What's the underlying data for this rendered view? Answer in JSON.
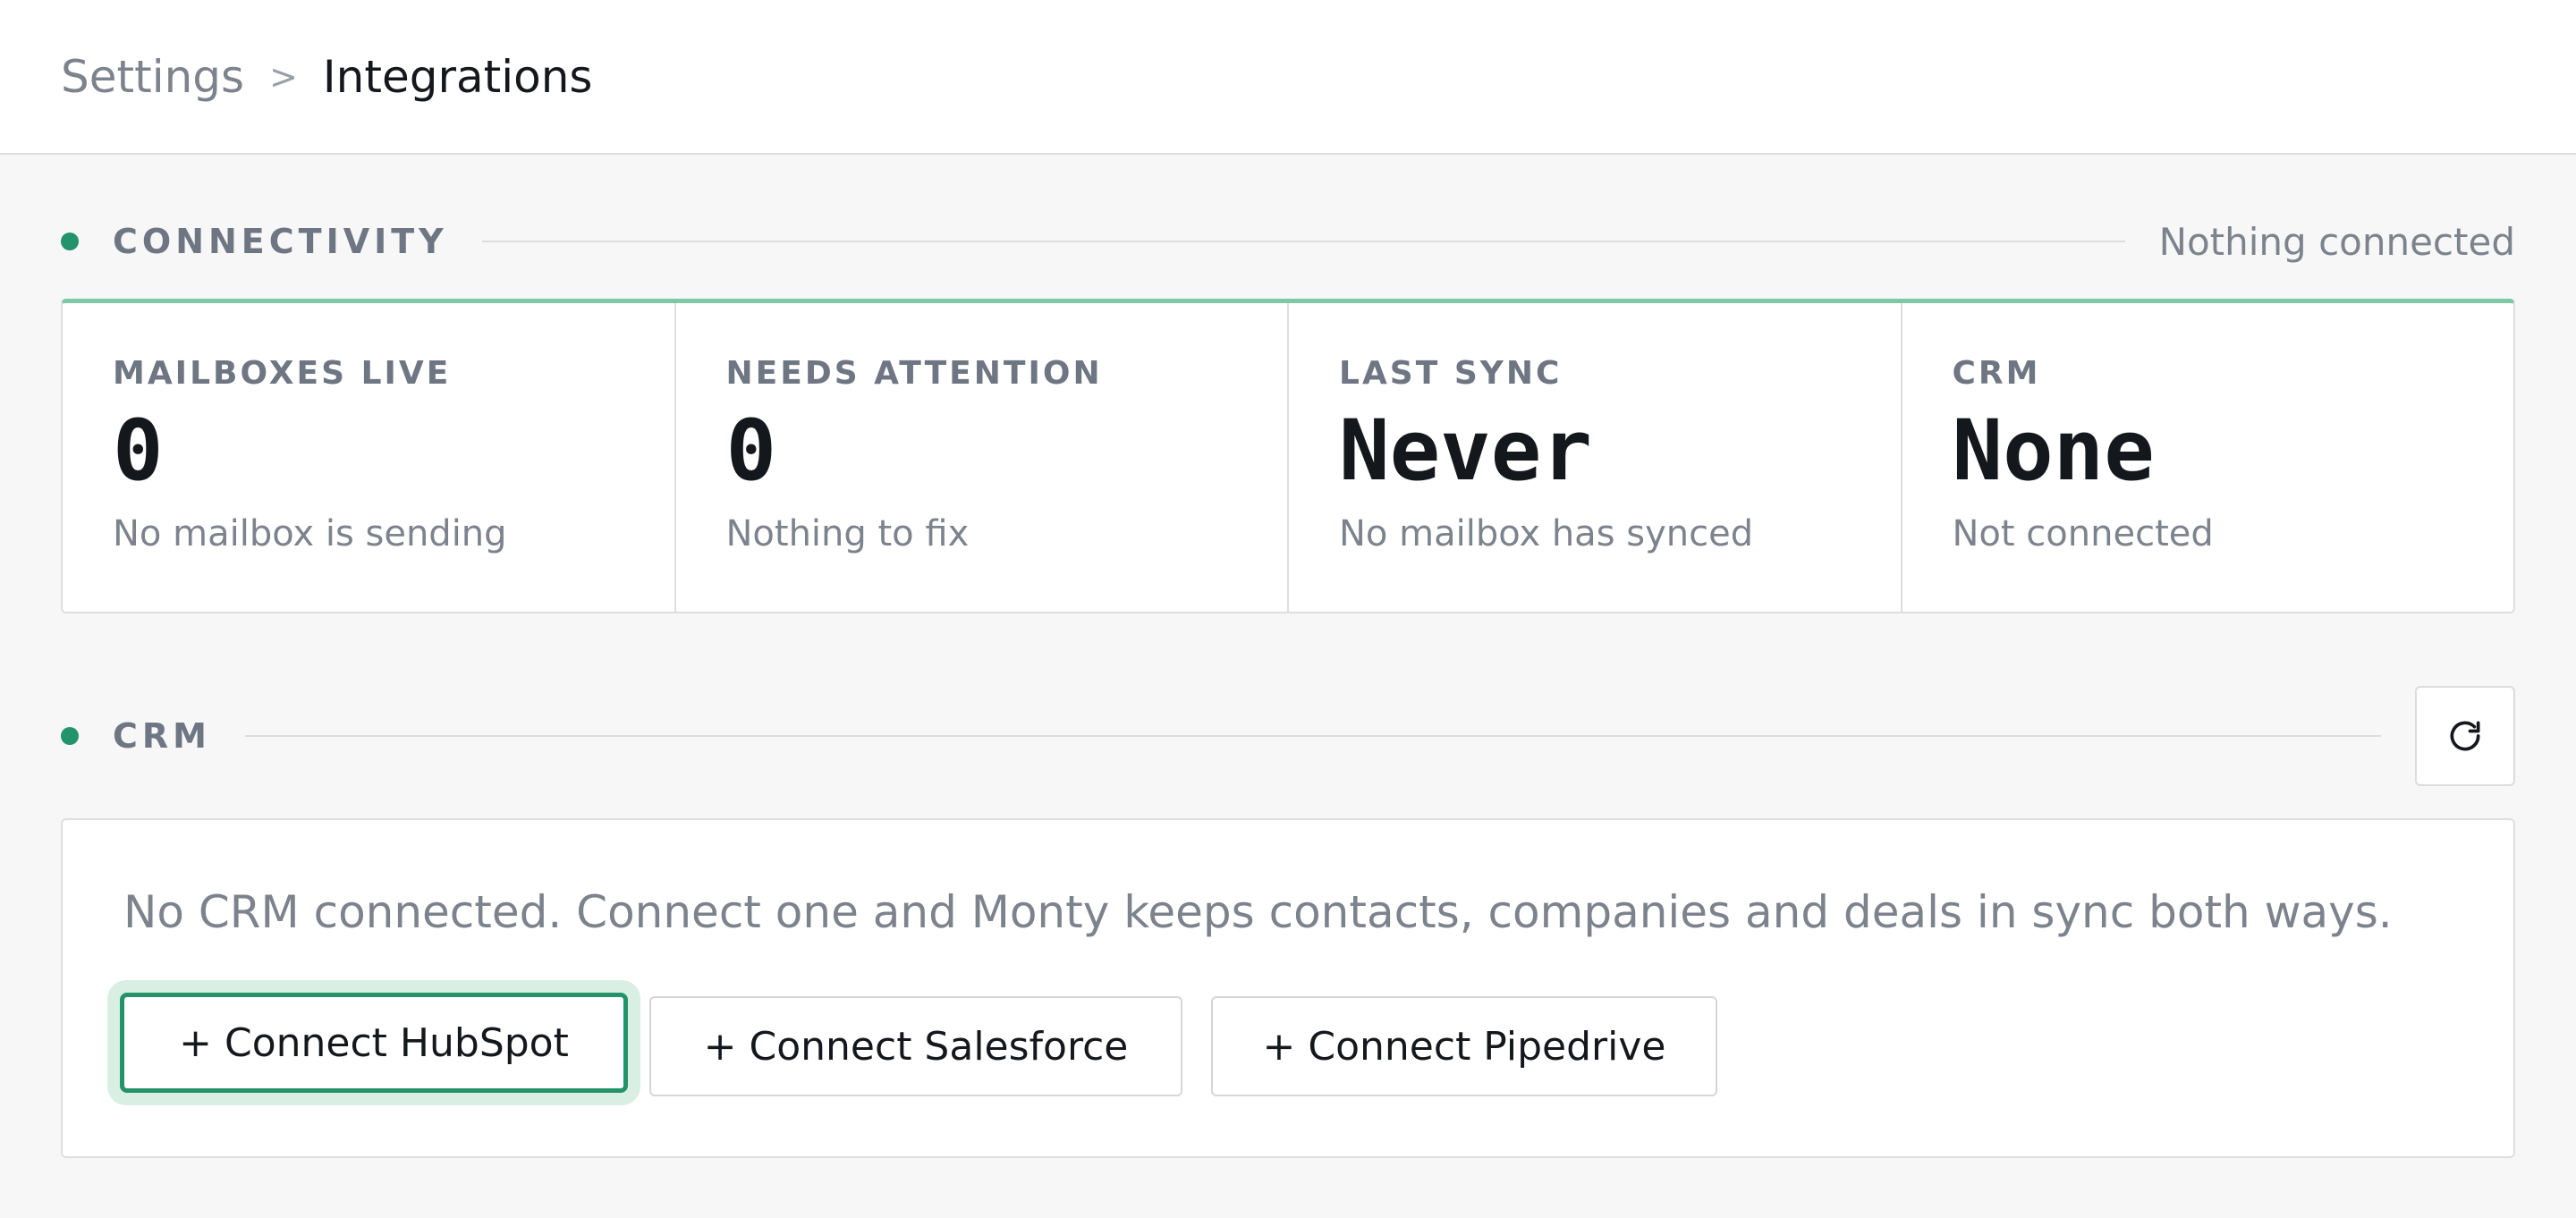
{
  "breadcrumb": {
    "root": "Settings",
    "separator": ">",
    "current": "Integrations"
  },
  "connectivity": {
    "label": "CONNECTIVITY",
    "status": "Nothing connected",
    "stats": [
      {
        "label": "MAILBOXES LIVE",
        "value": "0",
        "sub": "No mailbox is sending"
      },
      {
        "label": "NEEDS ATTENTION",
        "value": "0",
        "sub": "Nothing to fix"
      },
      {
        "label": "LAST SYNC",
        "value": "Never",
        "sub": "No mailbox has synced"
      },
      {
        "label": "CRM",
        "value": "None",
        "sub": "Not connected"
      }
    ]
  },
  "crm": {
    "label": "CRM",
    "refresh_icon": "refresh-icon",
    "description": "No CRM connected. Connect one and Monty keeps contacts, companies and deals in sync both ways.",
    "buttons": {
      "hubspot": "+ Connect HubSpot",
      "salesforce": "+ Connect Salesforce",
      "pipedrive": "+ Connect Pipedrive"
    }
  },
  "colors": {
    "accent": "#22936a",
    "accent_soft": "#d9efe4",
    "muted": "#7d838d"
  }
}
